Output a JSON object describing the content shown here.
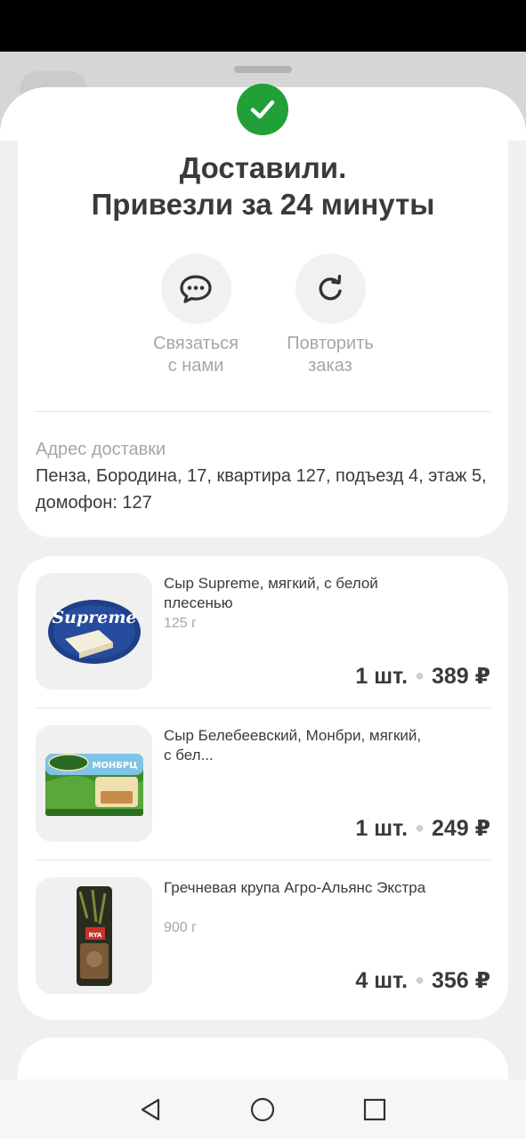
{
  "colors": {
    "accent": "#21a038",
    "text": "#3a3a3a",
    "muted": "#a6a6a6"
  },
  "header": {
    "title_line1": "Доставили.",
    "title_line2": "Привезли за 24 минуты",
    "status_icon": "check-icon"
  },
  "actions": [
    {
      "label": "Связаться\nс нами",
      "icon": "chat-icon"
    },
    {
      "label": "Повторить\nзаказ",
      "icon": "repeat-icon"
    }
  ],
  "address": {
    "label": "Адрес доставки",
    "text": "Пенза, Бородина, 17, квартира 127, подъезд 4, этаж 5, домофон: 127"
  },
  "items": [
    {
      "name": "Сыр Supreme, мягкий, с белой плесенью",
      "weight": "125 г",
      "qty": "1 шт.",
      "price": "389 ₽",
      "image": "supreme-cheese"
    },
    {
      "name": "Сыр Белебеевский, Монбри, мягкий, с бел...",
      "weight": "",
      "qty": "1 шт.",
      "price": "249 ₽",
      "image": "belebey-cheese"
    },
    {
      "name": "Гречневая крупа Агро-Альянс Экстра",
      "weight": "900 г",
      "qty": "4 шт.",
      "price": "356 ₽",
      "image": "buckwheat-pack"
    }
  ],
  "navigation": {
    "back": "back-icon",
    "home": "home-icon",
    "recents": "recents-icon"
  }
}
